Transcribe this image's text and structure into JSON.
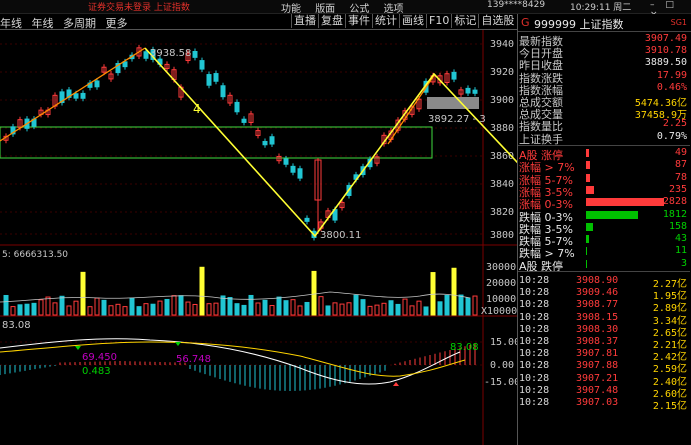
{
  "topbar": {
    "warning": "证券交易未登录  上证指数",
    "menu": [
      "功能",
      "版面",
      "公式",
      "选项"
    ],
    "user": "139****8429",
    "time": "10:29:11 周二",
    "window_controls": "– □ ×"
  },
  "toolbar": {
    "left_tabs": [
      "年线",
      "年线",
      "多周期",
      "更多"
    ],
    "right_tabs": [
      "直播",
      "复盘",
      "事件",
      "统计",
      "画线",
      "F10",
      "标记",
      "自选股"
    ]
  },
  "chart": {
    "price_axis": [
      "3940",
      "3920",
      "3900",
      "3880",
      "3860",
      "3840",
      "3820",
      "3800"
    ],
    "high_label": "3938.58",
    "low_label": "3800.11",
    "last_label": "3892.27 - 3",
    "wave_label": "4",
    "volume_label": "5: 6666313.50",
    "volume_axis": [
      "30000",
      "20000",
      "10000",
      "X10000"
    ],
    "macd_label": "83.08",
    "macd_axis": [
      "15.00",
      "0.00",
      "-15.00"
    ],
    "macd_right_label": "83.08",
    "macd_annot_1": "69.450",
    "macd_annot_2": "0.483",
    "macd_annot_3": "56.748"
  },
  "panel": {
    "icon": "G",
    "code": "999999 上证指数",
    "badge": "SG1",
    "rows": [
      {
        "k": "最新指数",
        "v": "3907.49",
        "c": "red"
      },
      {
        "k": "今日开盘",
        "v": "3910.78",
        "c": "red"
      },
      {
        "k": "昨日收盘",
        "v": "3889.50",
        "c": "wht"
      },
      {
        "k": "指数涨跌",
        "v": "17.99",
        "c": "red"
      },
      {
        "k": "指数涨幅",
        "v": "0.46%",
        "c": "red"
      },
      {
        "k": "总成交额",
        "v": "5474.36亿",
        "c": "yel"
      },
      {
        "k": "总成交量",
        "v": "37458.9万",
        "c": "yel"
      },
      {
        "k": "指数量比",
        "v": "2.25",
        "c": "red"
      },
      {
        "k": "上证换手",
        "v": "0.79%",
        "c": "wht"
      }
    ],
    "dist": [
      {
        "k": "A股 涨停",
        "v": "49",
        "c": "red",
        "w": 3
      },
      {
        "k": "涨幅 > 7%",
        "v": "87",
        "c": "red",
        "w": 4
      },
      {
        "k": "涨幅 5-7%",
        "v": "78",
        "c": "red",
        "w": 4
      },
      {
        "k": "涨幅 3-5%",
        "v": "235",
        "c": "red",
        "w": 8
      },
      {
        "k": "涨幅 0-3%",
        "v": "2828",
        "c": "red",
        "w": 78
      },
      {
        "k": "跌幅 0-3%",
        "v": "1812",
        "c": "grn",
        "w": 52
      },
      {
        "k": "跌幅 3-5%",
        "v": "158",
        "c": "grn",
        "w": 7
      },
      {
        "k": "跌幅 5-7%",
        "v": "43",
        "c": "grn",
        "w": 3
      },
      {
        "k": "跌幅 > 7%",
        "v": "11",
        "c": "grn",
        "w": 1
      },
      {
        "k": "A股 跌停",
        "v": "3",
        "c": "grn",
        "w": 1
      }
    ],
    "ticks": [
      {
        "t": "10:28",
        "p": "3908.90",
        "a": "2.27亿"
      },
      {
        "t": "10:28",
        "p": "3909.46",
        "a": "1.95亿"
      },
      {
        "t": "10:28",
        "p": "3908.77",
        "a": "2.89亿"
      },
      {
        "t": "10:28",
        "p": "3908.15",
        "a": "3.34亿"
      },
      {
        "t": "10:28",
        "p": "3908.30",
        "a": "2.65亿"
      },
      {
        "t": "10:28",
        "p": "3908.37",
        "a": "2.21亿"
      },
      {
        "t": "10:28",
        "p": "3907.81",
        "a": "2.42亿"
      },
      {
        "t": "10:28",
        "p": "3907.88",
        "a": "2.59亿"
      },
      {
        "t": "10:28",
        "p": "3907.21",
        "a": "2.40亿"
      },
      {
        "t": "10:28",
        "p": "3907.48",
        "a": "2.60亿"
      },
      {
        "t": "10:28",
        "p": "3907.03",
        "a": "2.15亿"
      }
    ]
  }
}
